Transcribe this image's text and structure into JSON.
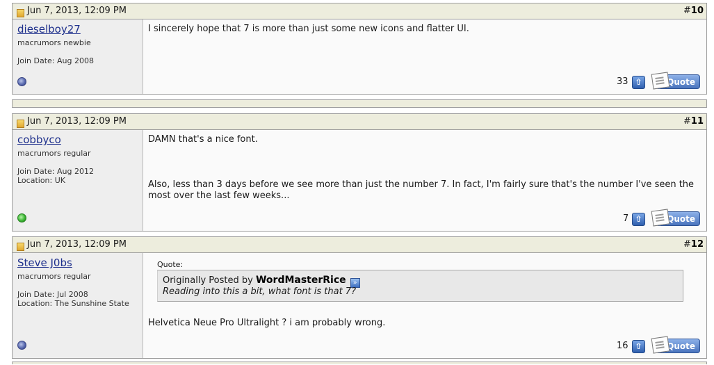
{
  "posts": [
    {
      "date": "Jun 7, 2013, 12:09 PM",
      "number_prefix": "#",
      "number": "10",
      "username": "dieselboy27",
      "user_title": "macrumors newbie",
      "join_date": "Join Date: Aug 2008",
      "location": "",
      "online": false,
      "message_lines": [
        "I sincerely hope that 7 is more than just some new icons and flatter UI."
      ],
      "votes": "33",
      "quote_label": "Quote"
    },
    {
      "date": "Jun 7, 2013, 12:09 PM",
      "number_prefix": "#",
      "number": "11",
      "username": "cobbyco",
      "user_title": "macrumors regular",
      "join_date": "Join Date: Aug 2012",
      "location": "Location: UK",
      "online": true,
      "message_lines": [
        "DAMN that's a nice font.",
        "Also, less than 3 days before we see more than just the number 7. In fact, I'm fairly sure that's the number I've seen the most over the last few weeks..."
      ],
      "votes": "7",
      "quote_label": "Quote"
    },
    {
      "date": "Jun 7, 2013, 12:09 PM",
      "number_prefix": "#",
      "number": "12",
      "username": "Steve J0bs",
      "user_title": "macrumors regular",
      "join_date": "Join Date: Jul 2008",
      "location": "Location: The Sunshine State",
      "online": false,
      "quote": {
        "label": "Quote:",
        "posted_by_prefix": "Originally Posted by",
        "author": "WordMasterRice",
        "text": "Reading into this a bit, what font is that 7?"
      },
      "message_lines": [
        "Helvetica Neue Pro Ultralight ? i am probably wrong."
      ],
      "votes": "16",
      "quote_label": "Quote"
    }
  ],
  "icons": {
    "post_status": "post-status-icon",
    "online_status": "online-status-icon",
    "vote_up": "vote-up-icon",
    "view_post": "view-post-icon"
  },
  "colors": {
    "header_bg": "#ededdd",
    "username_link": "#1d2f8c",
    "button_blue": "#4a74bd"
  }
}
